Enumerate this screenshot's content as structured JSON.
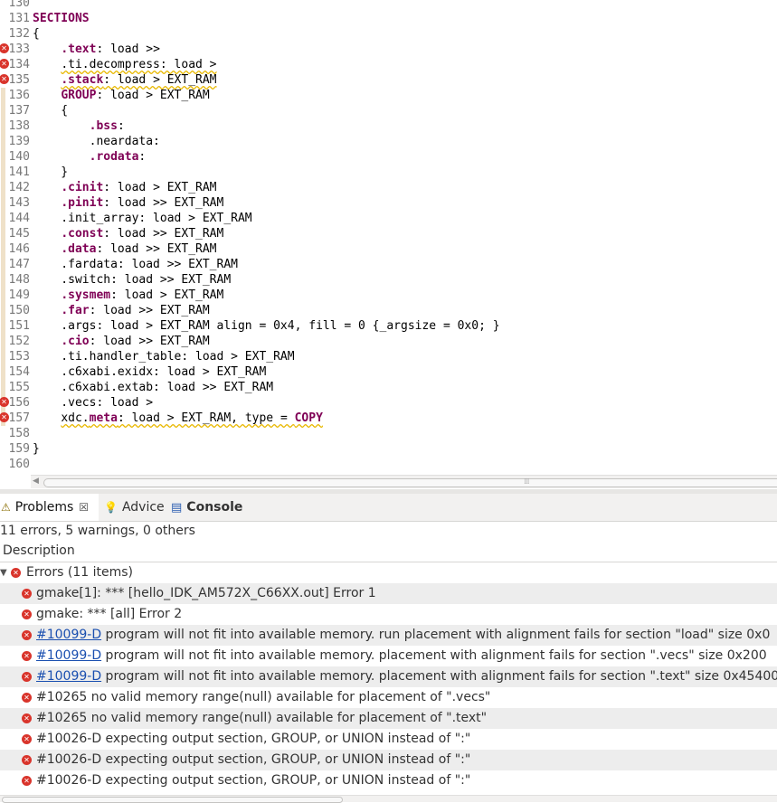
{
  "editor": {
    "lines": [
      {
        "num": "130",
        "tokens": []
      },
      {
        "num": "131",
        "tokens": [
          {
            "t": "SECTIONS",
            "c": "kw"
          }
        ]
      },
      {
        "num": "132",
        "tokens": [
          {
            "t": "{"
          }
        ]
      },
      {
        "num": "133",
        "err": true,
        "tokens": [
          {
            "t": "    "
          },
          {
            "t": ".text",
            "c": "kw"
          },
          {
            "t": ": load >>"
          }
        ]
      },
      {
        "num": "134",
        "err": true,
        "tokens": [
          {
            "t": "    "
          },
          {
            "t": ".ti.decompress: load >",
            "c": "squig"
          }
        ]
      },
      {
        "num": "135",
        "err": true,
        "tokens": [
          {
            "t": "    "
          },
          {
            "t": ".stack",
            "c": "kw squig"
          },
          {
            "t": ": load > EXT_RAM",
            "c": "squig"
          }
        ]
      },
      {
        "num": "136",
        "tokens": [
          {
            "t": "    "
          },
          {
            "t": "GROUP",
            "c": "kw"
          },
          {
            "t": ": load > EXT_RAM"
          }
        ]
      },
      {
        "num": "137",
        "tokens": [
          {
            "t": "    {"
          }
        ]
      },
      {
        "num": "138",
        "tokens": [
          {
            "t": "        "
          },
          {
            "t": ".bss",
            "c": "kw"
          },
          {
            "t": ":"
          }
        ]
      },
      {
        "num": "139",
        "tokens": [
          {
            "t": "        .neardata:"
          }
        ]
      },
      {
        "num": "140",
        "tokens": [
          {
            "t": "        "
          },
          {
            "t": ".rodata",
            "c": "kw"
          },
          {
            "t": ":"
          }
        ]
      },
      {
        "num": "141",
        "tokens": [
          {
            "t": "    }"
          }
        ]
      },
      {
        "num": "142",
        "tokens": [
          {
            "t": "    "
          },
          {
            "t": ".cinit",
            "c": "kw"
          },
          {
            "t": ": load > EXT_RAM"
          }
        ]
      },
      {
        "num": "143",
        "tokens": [
          {
            "t": "    "
          },
          {
            "t": ".pinit",
            "c": "kw"
          },
          {
            "t": ": load >> EXT_RAM"
          }
        ]
      },
      {
        "num": "144",
        "tokens": [
          {
            "t": "    .init_array: load > EXT_RAM"
          }
        ]
      },
      {
        "num": "145",
        "tokens": [
          {
            "t": "    "
          },
          {
            "t": ".const",
            "c": "kw"
          },
          {
            "t": ": load >> EXT_RAM"
          }
        ]
      },
      {
        "num": "146",
        "tokens": [
          {
            "t": "    "
          },
          {
            "t": ".data",
            "c": "kw"
          },
          {
            "t": ": load >> EXT_RAM"
          }
        ]
      },
      {
        "num": "147",
        "tokens": [
          {
            "t": "    .fardata: load >> EXT_RAM"
          }
        ]
      },
      {
        "num": "148",
        "tokens": [
          {
            "t": "    .switch: load >> EXT_RAM"
          }
        ]
      },
      {
        "num": "149",
        "tokens": [
          {
            "t": "    "
          },
          {
            "t": ".sysmem",
            "c": "kw"
          },
          {
            "t": ": load > EXT_RAM"
          }
        ]
      },
      {
        "num": "150",
        "tokens": [
          {
            "t": "    "
          },
          {
            "t": ".far",
            "c": "kw"
          },
          {
            "t": ": load >> EXT_RAM"
          }
        ]
      },
      {
        "num": "151",
        "tokens": [
          {
            "t": "    .args: load > EXT_RAM align = 0x4, fill = 0 {_argsize = 0x0; }"
          }
        ]
      },
      {
        "num": "152",
        "tokens": [
          {
            "t": "    "
          },
          {
            "t": ".cio",
            "c": "kw"
          },
          {
            "t": ": load >> EXT_RAM"
          }
        ]
      },
      {
        "num": "153",
        "tokens": [
          {
            "t": "    .ti.handler_table: load > EXT_RAM"
          }
        ]
      },
      {
        "num": "154",
        "tokens": [
          {
            "t": "    .c6xabi.exidx: load > EXT_RAM"
          }
        ]
      },
      {
        "num": "155",
        "tokens": [
          {
            "t": "    .c6xabi.extab: load >> EXT_RAM"
          }
        ]
      },
      {
        "num": "156",
        "err": true,
        "tokens": [
          {
            "t": "    .vecs: load >"
          }
        ]
      },
      {
        "num": "157",
        "err": true,
        "tokens": [
          {
            "t": "    "
          },
          {
            "t": "xdc.",
            "c": "squig"
          },
          {
            "t": "meta",
            "c": "kw squig"
          },
          {
            "t": ": load > EXT_RAM, type = ",
            "c": "squig"
          },
          {
            "t": "COPY",
            "c": "kw squig"
          }
        ]
      },
      {
        "num": "158",
        "tokens": []
      },
      {
        "num": "159",
        "tokens": [
          {
            "t": "}"
          }
        ]
      },
      {
        "num": "160",
        "tokens": []
      }
    ]
  },
  "tabs": [
    {
      "label": "Problems",
      "icon": "problems-icon",
      "glyph": "⚠",
      "active": true,
      "close": "☒"
    },
    {
      "label": "Advice",
      "icon": "lightbulb-icon",
      "glyph": "💡",
      "active": false
    },
    {
      "label": "Console",
      "icon": "console-icon",
      "glyph": "▤",
      "active": false
    }
  ],
  "problems": {
    "summary": "11 errors, 5 warnings, 0 others",
    "column_header": "Description",
    "group_label": "Errors (11 items)",
    "items": [
      {
        "link": "",
        "text": "gmake[1]: *** [hello_IDK_AM572X_C66XX.out] Error 1"
      },
      {
        "link": "",
        "text": "gmake: *** [all] Error 2"
      },
      {
        "link": "#10099-D",
        "text": " program will not fit into available memory.  run placement with alignment fails for section \"load\" size 0x0"
      },
      {
        "link": "#10099-D",
        "text": " program will not fit into available memory.  placement with alignment fails for section \".vecs\" size 0x200"
      },
      {
        "link": "#10099-D",
        "text": " program will not fit into available memory.  placement with alignment fails for section \".text\" size 0x45400"
      },
      {
        "link": "",
        "text": "#10265 no valid memory range(null) available for placement of \".vecs\""
      },
      {
        "link": "",
        "text": "#10265 no valid memory range(null) available for placement of \".text\""
      },
      {
        "link": "",
        "text": "#10026-D expecting output section, GROUP, or UNION instead of \":\""
      },
      {
        "link": "",
        "text": "#10026-D expecting output section, GROUP, or UNION instead of \":\""
      },
      {
        "link": "",
        "text": "#10026-D expecting output section, GROUP, or UNION instead of \":\""
      }
    ]
  },
  "colors": {
    "keyword": "#7f0055",
    "error": "#d9342b",
    "link": "#1a4fb0",
    "warning_squiggle": "#e8b800"
  }
}
